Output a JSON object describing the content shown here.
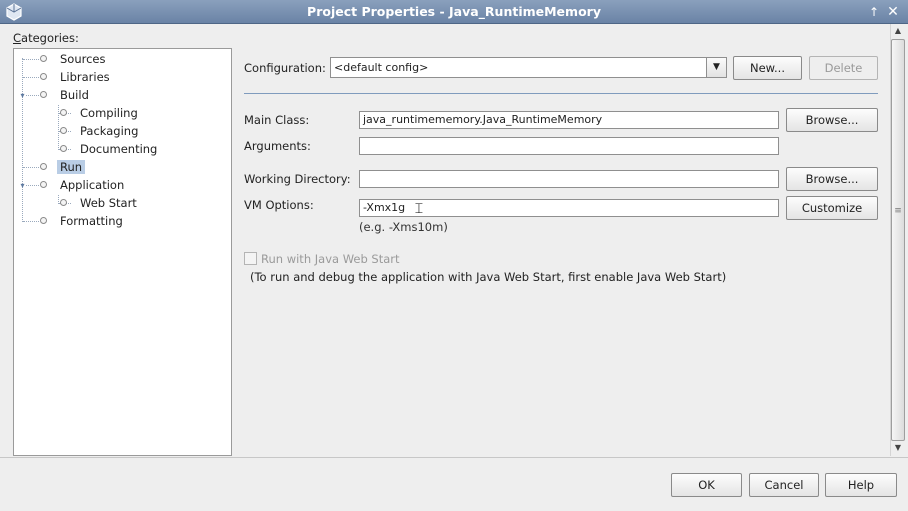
{
  "window": {
    "title": "Project Properties - Java_RuntimeMemory",
    "icons": {
      "app": "netbeans-cube-icon",
      "up": "arrow-up-icon",
      "close": "close-icon"
    }
  },
  "categories": {
    "label": "Categories:",
    "items": [
      {
        "label": "Sources"
      },
      {
        "label": "Libraries"
      },
      {
        "label": "Build"
      },
      {
        "label": "Compiling"
      },
      {
        "label": "Packaging"
      },
      {
        "label": "Documenting"
      },
      {
        "label": "Run"
      },
      {
        "label": "Application"
      },
      {
        "label": "Web Start"
      },
      {
        "label": "Formatting"
      }
    ],
    "selected": "Run"
  },
  "run": {
    "configuration": {
      "label": "Configuration:",
      "value": "<default config>",
      "new_label": "New...",
      "delete_label": "Delete"
    },
    "main_class": {
      "label": "Main Class:",
      "value": "java_runtimememory.Java_RuntimeMemory",
      "browse_label": "Browse..."
    },
    "arguments": {
      "label": "Arguments:",
      "value": ""
    },
    "working_directory": {
      "label": "Working Directory:",
      "value": "",
      "browse_label": "Browse..."
    },
    "vm_options": {
      "label": "VM Options:",
      "value": "-Xmx1g",
      "customize_label": "Customize",
      "hint": "(e.g. -Xms10m)"
    },
    "web_start": {
      "checkbox_label": "Run with Java Web Start",
      "checked": false,
      "note": "(To run and debug the application with Java Web Start, first enable Java Web Start)"
    }
  },
  "footer": {
    "ok_label": "OK",
    "cancel_label": "Cancel",
    "help_label": "Help"
  },
  "colors": {
    "titlebar": "#7890b2",
    "selection": "#b9cde5",
    "divider": "#7f9bbd"
  }
}
